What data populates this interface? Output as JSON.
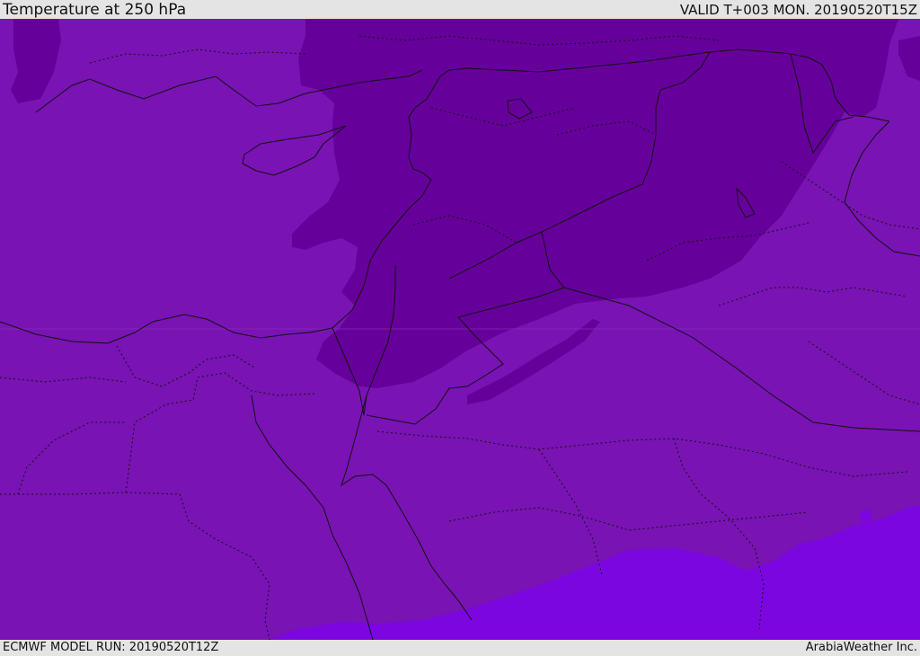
{
  "header": {
    "title": "Temperature at 250 hPa",
    "valid_time": "VALID T+003 MON. 20190520T15Z"
  },
  "footer": {
    "model_run": "ECMWF MODEL RUN: 20190520T12Z",
    "credit": "ArabiaWeather Inc."
  },
  "colors": {
    "field_base": "#7913b3",
    "field_cold": "#66009a",
    "field_warm": "#7b06e0",
    "border_line": "#111111"
  }
}
